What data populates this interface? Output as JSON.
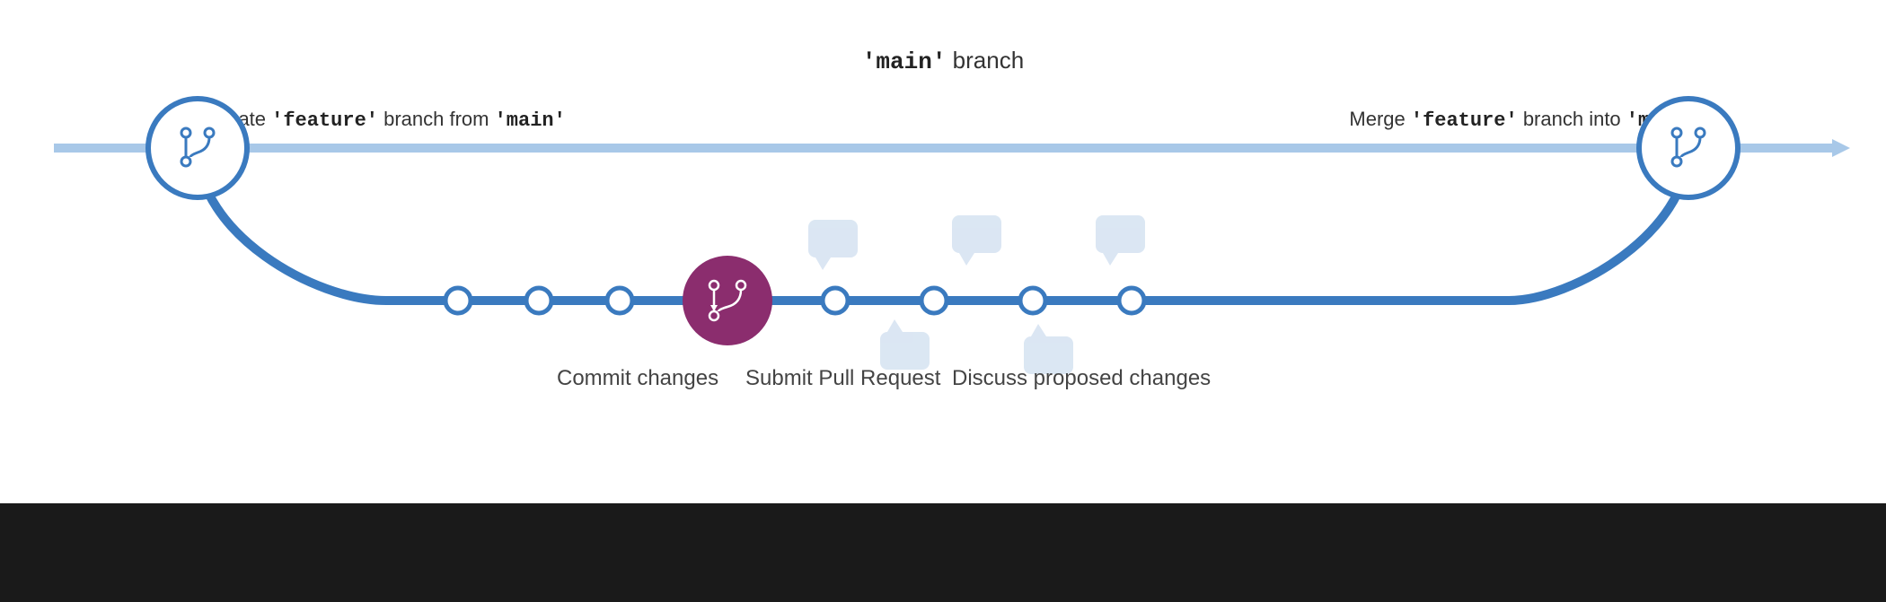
{
  "diagram": {
    "main_branch_label": "'main' branch",
    "main_branch_code": "main",
    "create_label_prefix": "Create ",
    "create_feature_code": "'feature'",
    "create_label_middle": " branch from ",
    "create_main_code": "'main'",
    "merge_label_prefix": "Merge ",
    "merge_feature_code": "'feature'",
    "merge_label_middle": " branch into ",
    "merge_main_code": "'main'",
    "label_commit": "Commit changes",
    "label_pr": "Submit Pull Request",
    "label_discuss": "Discuss proposed changes",
    "colors": {
      "main_line": "#a8c8e8",
      "feature_line": "#3a7abf",
      "node_fill": "#ffffff",
      "node_stroke": "#3a7abf",
      "pr_node_fill": "#8b2d6e",
      "branch_circle_stroke": "#3a7abf",
      "branch_circle_fill": "#ffffff",
      "comment_bubble": "#b8cfe8"
    }
  }
}
